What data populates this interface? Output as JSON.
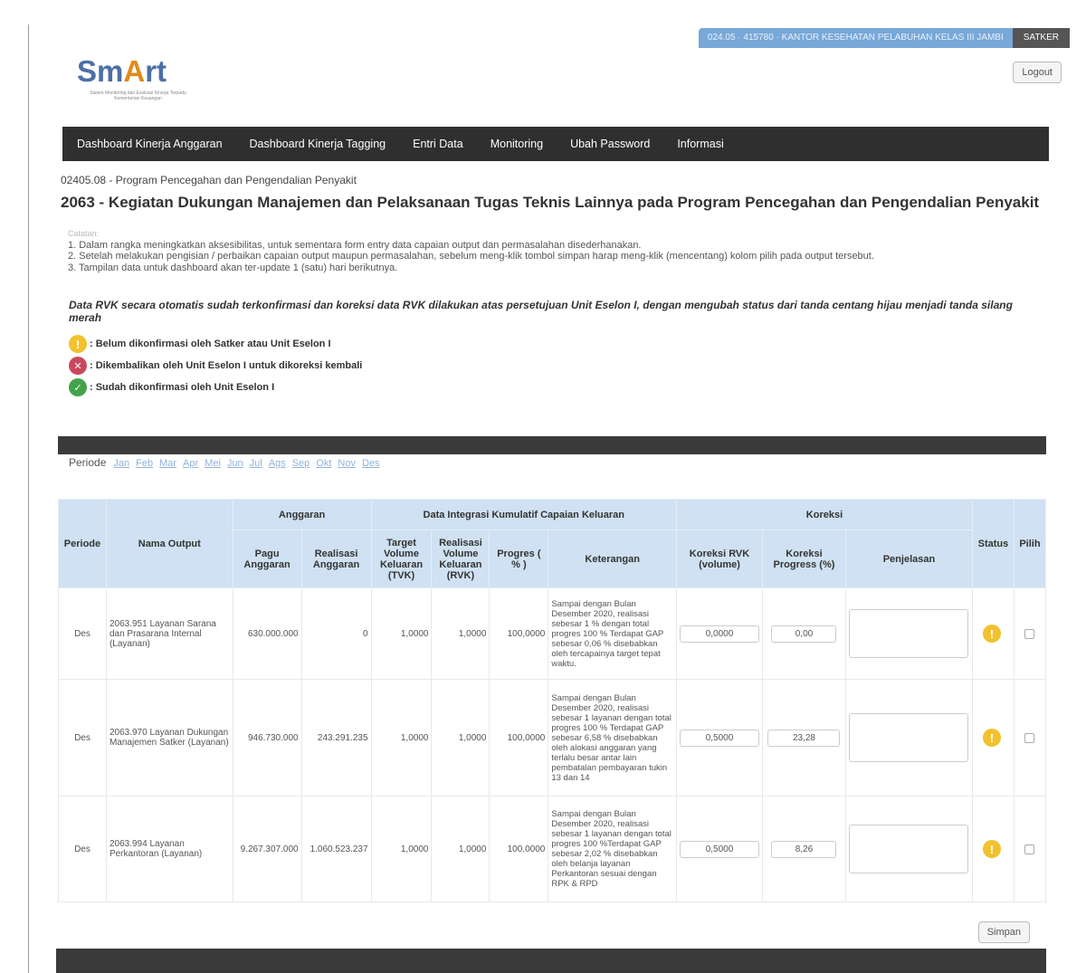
{
  "header": {
    "satker_info": "024.05 · 415780 · KANTOR KESEHATAN PELABUHAN KELAS III JAMBI",
    "role": "SATKER",
    "logout": "Logout",
    "logo_prefix": "Sm",
    "logo_a": "A",
    "logo_suffix": "rt",
    "logo_tagline": "Sistem Monitoring dan Evaluasi Kinerja Terpadu Kementerian Keuangan"
  },
  "nav": {
    "items": [
      "Dashboard Kinerja Anggaran",
      "Dashboard Kinerja Tagging",
      "Entri Data",
      "Monitoring",
      "Ubah Password",
      "Informasi"
    ]
  },
  "page": {
    "program": "02405.08 - Program Pencegahan dan Pengendalian Penyakit",
    "title": "2063 - Kegiatan Dukungan Manajemen dan Pelaksanaan Tugas Teknis Lainnya pada Program Pencegahan dan Pengendalian Penyakit"
  },
  "notes": {
    "heading": "Catatan:",
    "lines": [
      "1. Dalam rangka meningkatkan aksesibilitas, untuk sementara form entry data capaian output dan permasalahan disederhanakan.",
      "2. Setelah melakukan pengisian / perbaikan capaian output maupun permasalahan, sebelum meng-klik tombol simpan harap meng-klik (mencentang) kolom pilih pada output tersebut.",
      "3. Tampilan data untuk dashboard akan ter-update 1 (satu) hari berikutnya."
    ],
    "notice": "Data RVK secara otomatis sudah terkonfirmasi dan koreksi data RVK dilakukan atas persetujuan Unit Eselon I, dengan mengubah status dari tanda centang hijau menjadi tanda silang merah"
  },
  "legend": {
    "warn": ": Belum dikonfirmasi oleh Satker atau Unit Eselon I",
    "err": ": Dikembalikan oleh Unit Eselon I untuk dikoreksi kembali",
    "ok": ": Sudah dikonfirmasi oleh Unit Eselon I"
  },
  "periode": {
    "label": "Periode",
    "months": [
      "Jan",
      "Feb",
      "Mar",
      "Apr",
      "Mei",
      "Jun",
      "Jul",
      "Ags",
      "Sep",
      "Okt",
      "Nov",
      "Des"
    ]
  },
  "table": {
    "h_periode": "Periode",
    "h_nama": "Nama Output",
    "h_anggaran": "Anggaran",
    "h_integrasi": "Data Integrasi Kumulatif Capaian Keluaran",
    "h_koreksi": "Koreksi",
    "h_status": "Status",
    "h_pilih": "Pilih",
    "h_pagu": "Pagu Anggaran",
    "h_realisasi": "Realisasi Anggaran",
    "h_target": "Target Volume Keluaran (TVK)",
    "h_rvk": "Realisasi Volume Keluaran (RVK)",
    "h_progres": "Progres ( % )",
    "h_keterangan": "Keterangan",
    "h_koreksi_rvk": "Koreksi RVK (volume)",
    "h_koreksi_prog": "Koreksi Progress (%)",
    "h_penjelasan": "Penjelasan",
    "rows": [
      {
        "periode": "Des",
        "nama": "2063.951 Layanan Sarana dan Prasarana Internal (Layanan)",
        "pagu": "630.000.000",
        "realisasi": "0",
        "target": "1,0000",
        "rvk": "1,0000",
        "progres": "100,0000",
        "keterangan": "Sampai dengan Bulan Desember 2020, realisasi sebesar 1 % dengan total progres 100 % Terdapat GAP sebesar 0,06 % disebabkan oleh tercapainya target tepat waktu.",
        "koreksi_rvk": "0,0000",
        "koreksi_prog": "0,00"
      },
      {
        "periode": "Des",
        "nama": "2063.970 Layanan Dukungan Manajemen Satker (Layanan)",
        "pagu": "946.730.000",
        "realisasi": "243.291.235",
        "target": "1,0000",
        "rvk": "1,0000",
        "progres": "100,0000",
        "keterangan": "Sampai dengan Bulan Desember 2020, realisasi sebesar 1 layanan dengan total progres 100 % Terdapat GAP sebesar 6,58 % disebabkan oleh alokasi anggaran yang terlalu besar antar lain pembatalan pembayaran tukin 13 dan 14",
        "koreksi_rvk": "0,5000",
        "koreksi_prog": "23,28"
      },
      {
        "periode": "Des",
        "nama": "2063.994 Layanan Perkantoran (Layanan)",
        "pagu": "9.267.307.000",
        "realisasi": "1.060.523.237",
        "target": "1,0000",
        "rvk": "1,0000",
        "progres": "100,0000",
        "keterangan": "Sampai dengan Bulan Desember 2020, realisasi sebesar 1 layanan dengan total progres 100 %Terdapat GAP sebesar 2,02 % disebabkan oleh belanja layanan Perkantoran sesuai dengan RPK & RPD",
        "koreksi_rvk": "0,5000",
        "koreksi_prog": "8,26"
      }
    ]
  },
  "simpan": "Simpan"
}
